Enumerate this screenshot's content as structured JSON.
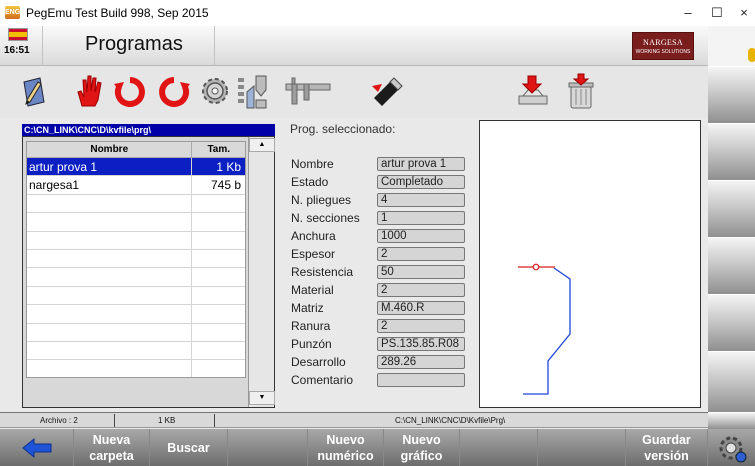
{
  "window": {
    "title": "PegEmu Test Build 998, Sep 2015",
    "app_icon_text": "ENG",
    "minimize": "–",
    "maximize": "☐",
    "close": "×"
  },
  "header": {
    "time": "16:51",
    "title": "Programas",
    "brand_name": "NARGESA",
    "brand_tagline": "WORKING SOLUTIONS"
  },
  "toolbar": {
    "icons": [
      "pencil-icon",
      "hand-icon",
      "refresh-cw-icon",
      "refresh-ccw-icon",
      "gear-icon",
      "tooling-icon",
      "caliper-icon",
      "usb-icon",
      "import-icon",
      "trash-icon"
    ]
  },
  "file_list": {
    "path": "C:\\CN_LINK\\CNC\\D\\kvfile\\prg\\",
    "columns": [
      "Nombre",
      "Tam."
    ],
    "rows": [
      {
        "name": "artur prova 1",
        "size": "1 Kb",
        "selected": true
      },
      {
        "name": "nargesa1",
        "size": "745 b",
        "selected": false
      },
      {
        "name": "",
        "size": ""
      },
      {
        "name": "",
        "size": ""
      },
      {
        "name": "",
        "size": ""
      },
      {
        "name": "",
        "size": ""
      },
      {
        "name": "",
        "size": ""
      },
      {
        "name": "",
        "size": ""
      },
      {
        "name": "",
        "size": ""
      },
      {
        "name": "",
        "size": ""
      },
      {
        "name": "",
        "size": ""
      },
      {
        "name": "",
        "size": ""
      }
    ]
  },
  "info": {
    "title": "Prog. seleccionado:",
    "fields": [
      {
        "label": "Nombre",
        "value": "artur prova 1"
      },
      {
        "label": "Estado",
        "value": "Completado"
      },
      {
        "label": "N. pliegues",
        "value": "4"
      },
      {
        "label": "N. secciones",
        "value": "1"
      },
      {
        "label": "Anchura",
        "value": "1000"
      },
      {
        "label": "Espesor",
        "value": "2"
      },
      {
        "label": "Resistencia",
        "value": "50"
      },
      {
        "label": "Material",
        "value": "2"
      },
      {
        "label": "Matriz",
        "value": "M.460.R"
      },
      {
        "label": "Ranura",
        "value": "2"
      },
      {
        "label": "Punzón",
        "value": "PS.135.85.R08"
      },
      {
        "label": "Desarrollo",
        "value": "289.26"
      },
      {
        "label": "Comentario",
        "value": ""
      }
    ]
  },
  "colors": {
    "selection": "#0b1fc3",
    "path_bar": "#0000a8",
    "profile_line": "#2046d8",
    "profile_marker": "#d81e1e"
  },
  "status": {
    "archivo": "Archivo : 2",
    "size": "1 KB",
    "path": "C:\\CN_LINK\\CNC\\D\\Kvfile\\Prg\\"
  },
  "buttons": {
    "back": "back-arrow-icon",
    "nueva_carpeta_1": "Nueva",
    "nueva_carpeta_2": "carpeta",
    "buscar": "Buscar",
    "nuevo_numerico_1": "Nuevo",
    "nuevo_numerico_2": "numérico",
    "nuevo_grafico_1": "Nuevo",
    "nuevo_grafico_2": "gráfico",
    "guardar_version_1": "Guardar",
    "guardar_version_2": "versión",
    "settings": "gear-icon"
  }
}
